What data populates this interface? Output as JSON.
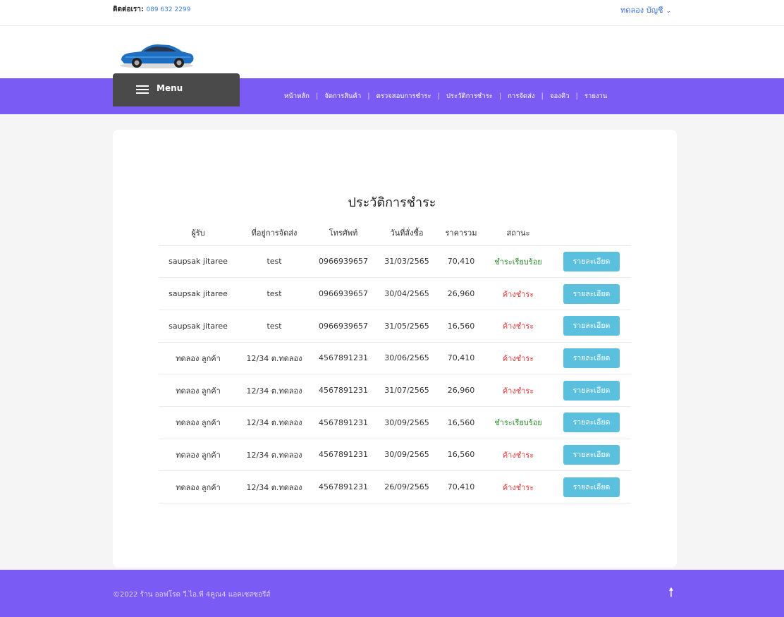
{
  "topbar": {
    "contact_label": "ติดต่อเรา:",
    "contact_phone": "089 632 2299",
    "account_label": "ทดลอง บัญชี",
    "account_chevron": "⌄"
  },
  "logo": {
    "icon": "car-logo-icon",
    "color": "#1e6fc2"
  },
  "menu": {
    "label": "Menu",
    "icon": "hamburger-icon"
  },
  "nav": {
    "items": [
      "หน้าหลัก",
      "จัดการสินค้า",
      "ตรวจสอบการชำระ",
      "ประวัติการชำระ",
      "การจัดส่ง",
      "จองคิว",
      "รายงาน"
    ]
  },
  "page": {
    "title": "ประวัติการชำระ"
  },
  "table": {
    "headers": [
      "ผู้รับ",
      "ที่อยู่การจัดส่ง",
      "โทรศัพท์",
      "วันที่สั่งซื้อ",
      "ราคารวม",
      "สถานะ",
      ""
    ],
    "detail_label": "รายละเอียด",
    "rows": [
      [
        "saupsak jitaree",
        "test",
        "0966939657",
        "31/03/2565",
        "70,410",
        "ชำระเรียบร้อย"
      ],
      [
        "saupsak jitaree",
        "test",
        "0966939657",
        "30/04/2565",
        "26,960",
        "ค้างชำระ"
      ],
      [
        "saupsak jitaree",
        "test",
        "0966939657",
        "31/05/2565",
        "16,560",
        "ค้างชำระ"
      ],
      [
        "ทดลอง ลูกค้า",
        "12/34 ต.ทดลอง",
        "4567891231",
        "30/06/2565",
        "70,410",
        "ค้างชำระ"
      ],
      [
        "ทดลอง ลูกค้า",
        "12/34 ต.ทดลอง",
        "4567891231",
        "31/07/2565",
        "26,960",
        "ค้างชำระ"
      ],
      [
        "ทดลอง ลูกค้า",
        "12/34 ต.ทดลอง",
        "4567891231",
        "30/09/2565",
        "16,560",
        "ชำระเรียบร้อย"
      ],
      [
        "ทดลอง ลูกค้า",
        "12/34 ต.ทดลอง",
        "4567891231",
        "30/09/2565",
        "16,560",
        "ค้างชำระ"
      ],
      [
        "ทดลอง ลูกค้า",
        "12/34 ต.ทดลอง",
        "4567891231",
        "26/09/2565",
        "70,410",
        "ค้างชำระ"
      ]
    ]
  },
  "footer": {
    "copyright": "©2022 ร้าน ออฟโรด วี.ไอ.พี 4คูณ4 แอคเซสซอรีส์",
    "up_arrow": "🠕"
  },
  "colors": {
    "nav_bg": "#7a5cf5",
    "menu_bg": "#4a4a4a",
    "button_bg": "#5bc0de",
    "paid": "#2f8a2f",
    "unpaid": "#e23a3a"
  }
}
